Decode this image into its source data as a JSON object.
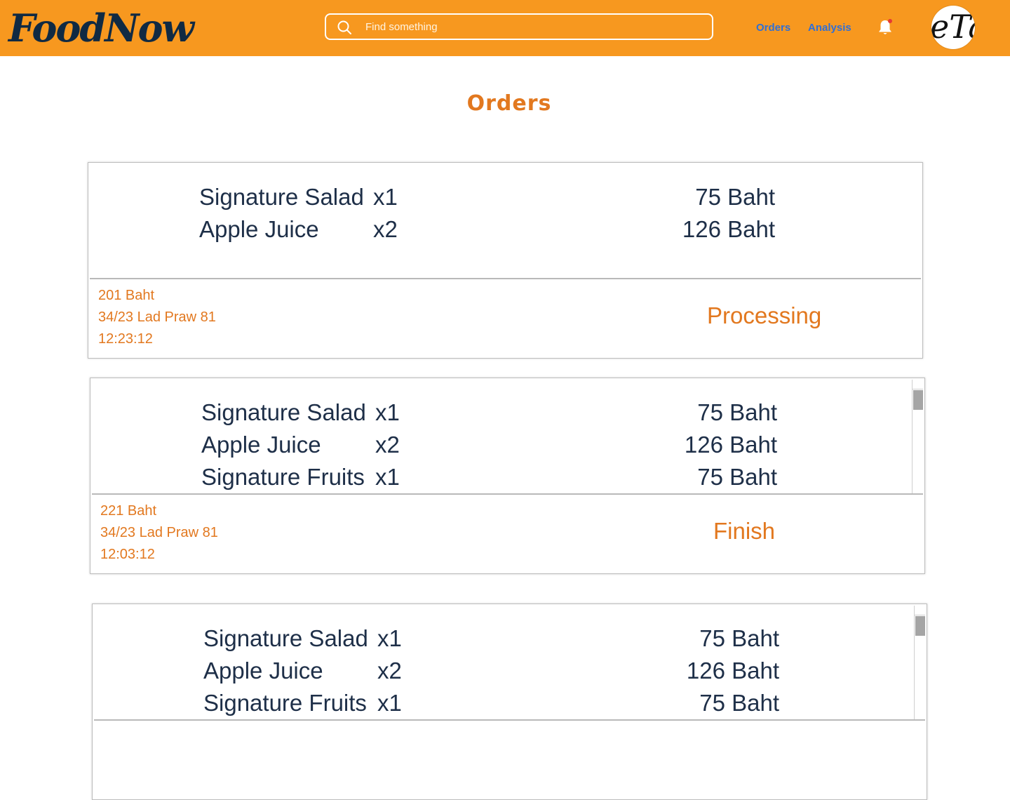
{
  "header": {
    "logo": "FoodNow",
    "search_placeholder": "Find something",
    "search_icon": "search-icon",
    "nav": [
      {
        "label": "Orders"
      },
      {
        "label": "Analysis"
      }
    ],
    "notification_icon": "bell-icon",
    "notification_dot_color": "#e53935",
    "avatar_text": "eTal"
  },
  "page": {
    "title": "Orders"
  },
  "colors": {
    "header_bg": "#f7981f",
    "accent": "#e2781f",
    "item_text": "#1e2f48",
    "nav_link": "#2f6fd6"
  },
  "orders": [
    {
      "items": [
        {
          "name": "Signature Salad",
          "qty": "x1",
          "price": "75 Baht"
        },
        {
          "name": "Apple Juice",
          "qty": "x2",
          "price": "126 Baht"
        }
      ],
      "total": "201 Baht",
      "address": "34/23 Lad Praw 81",
      "time": "12:23:12",
      "status": "Processing"
    },
    {
      "items": [
        {
          "name": "Signature Salad",
          "qty": "x1",
          "price": "75 Baht"
        },
        {
          "name": "Apple Juice",
          "qty": "x2",
          "price": "126 Baht"
        },
        {
          "name": "Signature Fruits",
          "qty": "x1",
          "price": "75 Baht"
        }
      ],
      "total": "221 Baht",
      "address": "34/23 Lad Praw 81",
      "time": "12:03:12",
      "status": "Finish"
    },
    {
      "items": [
        {
          "name": "Signature Salad",
          "qty": "x1",
          "price": "75 Baht"
        },
        {
          "name": "Apple Juice",
          "qty": "x2",
          "price": "126 Baht"
        },
        {
          "name": "Signature Fruits",
          "qty": "x1",
          "price": "75 Baht"
        }
      ],
      "total": "",
      "address": "",
      "time": "",
      "status": ""
    }
  ]
}
